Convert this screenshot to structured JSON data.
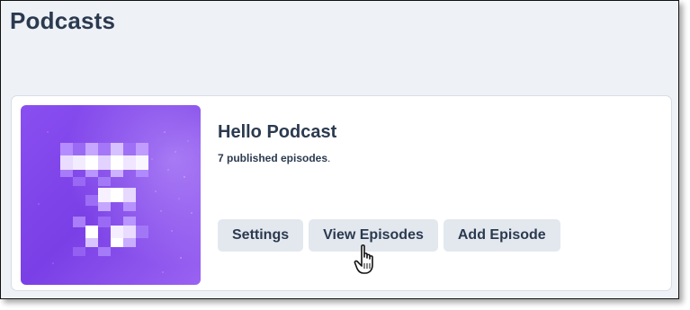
{
  "page": {
    "title": "Podcasts"
  },
  "podcast": {
    "title": "Hello Podcast",
    "episodes_count": "7 published episodes",
    "episodes_suffix": ".",
    "cover_color": "#7a3fe6"
  },
  "actions": {
    "settings_label": "Settings",
    "view_episodes_label": "View Episodes",
    "add_episode_label": "Add Episode"
  },
  "colors": {
    "title_text": "#2b3a4f",
    "page_bg": "#eef1f6",
    "button_bg": "#e3e8ef"
  },
  "cursor": {
    "icon": "hand-pointer-icon"
  }
}
